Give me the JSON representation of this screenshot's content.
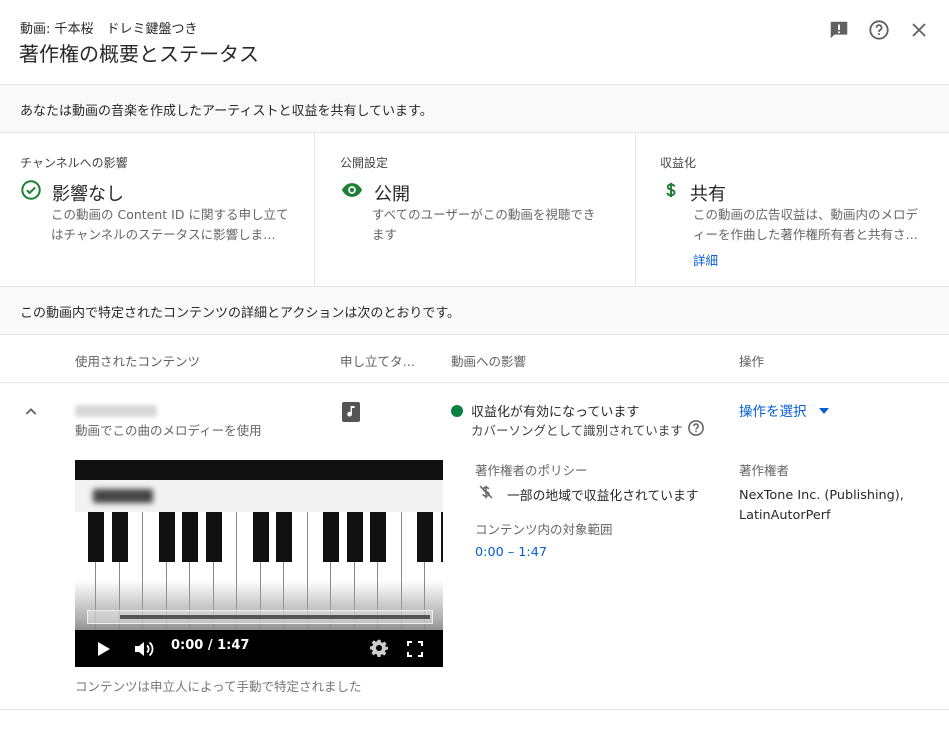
{
  "header": {
    "subtitle": "動画: 千本桜　ドレミ鍵盤つき",
    "title": "著作権の概要とステータス",
    "icons": [
      "feedback-icon",
      "help-icon",
      "close-icon"
    ]
  },
  "banner": {
    "text": "あなたは動画の音楽を作成したアーティストと収益を共有しています。"
  },
  "cards": [
    {
      "label": "チャンネルへの影響",
      "status": "影響なし",
      "icon": "check-circle-icon",
      "description_line1": "この動画の Content ID に関する申し立て",
      "description_line2": "はチャンネルのステータスに影響しま…"
    },
    {
      "label": "公開設定",
      "status": "公開",
      "icon": "eye-icon",
      "description_line1": "すべてのユーザーがこの動画を視聴でき",
      "description_line2": "ます"
    },
    {
      "label": "収益化",
      "status": "共有",
      "icon": "dollar-icon",
      "description_line1": "この動画の広告収益は、動画内のメロデ",
      "description_line2": "ィーを作曲した著作権所有者と共有さ…",
      "link": "詳細"
    }
  ],
  "banner2": {
    "text": "この動画内で特定されたコンテンツの詳細とアクションは次のとおりです。"
  },
  "table": {
    "headers": [
      "使用されたコンテンツ",
      "申し立てタ…",
      "動画への影響",
      "操作"
    ]
  },
  "claim": {
    "usage": "動画でこの曲のメロディーを使用",
    "impact_status": "収益化が有効になっています",
    "impact_detail": "カバーソングとして識別されています",
    "action_label": "操作を選択",
    "policy_label": "著作権者のポリシー",
    "policy_value": "一部の地域で収益化されています",
    "range_label": "コンテンツ内の対象範囲",
    "range_value": "0:00 – 1:47",
    "owner_label": "著作権者",
    "owner_line1": "NexTone Inc. (Publishing),",
    "owner_line2": "LatinAutorPerf",
    "footnote": "コンテンツは申立人によって手動で特定されました"
  },
  "player": {
    "time": "0:00 / 1:47",
    "progress": 0
  },
  "colors": {
    "success_green": "#0f9d58",
    "dark_green": "#1e7e34",
    "link_blue": "#065fd4",
    "status_dot": "#0b8043"
  }
}
